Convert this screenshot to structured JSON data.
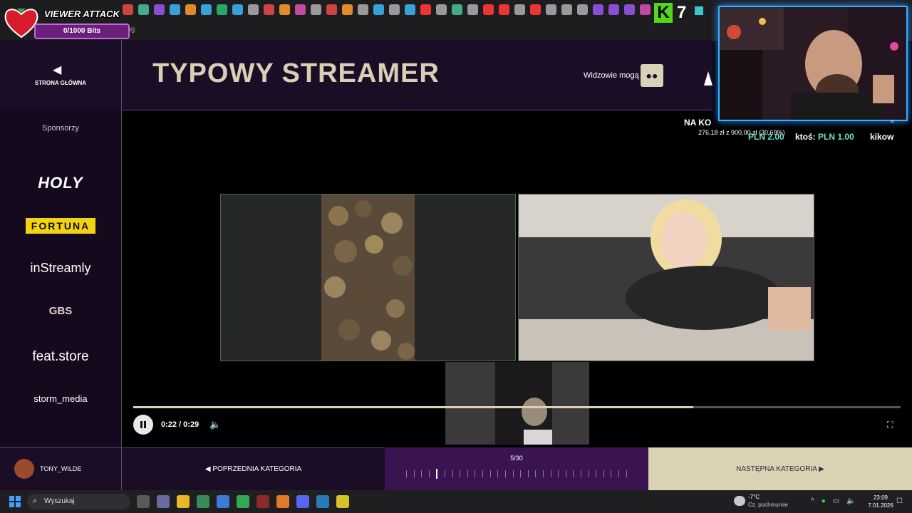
{
  "overlay": {
    "viewer_attack_title": "VIEWER ATTACK",
    "viewer_attack_progress": "0/1000 Bits",
    "k_badge_count": "7"
  },
  "browser": {
    "bookmark_text": "ing"
  },
  "header": {
    "home_label": "STRONA GŁÓWNA",
    "title": "TYPOWY STREAMER",
    "viewers_label": "Widzowie mogą"
  },
  "sidebar": {
    "title": "Sponsorzy",
    "sponsors": [
      "HOLY",
      "FORTUNA",
      "inStreamly",
      "GBS",
      "feat.store",
      "storm_media"
    ]
  },
  "donations": {
    "goal_title": "NA KO",
    "goal_amount": "276,18 zł z 900,00 zł (30,69%)",
    "ticker_1": "PLN 2.00",
    "ticker_2_name": "ktoś:",
    "ticker_2_amount": "PLN 1.00",
    "ticker_3": "kikow"
  },
  "player": {
    "time": "0:22 / 0:29",
    "progress": 0.73
  },
  "footer": {
    "username": "TONY_WILDE",
    "prev_label": "POPRZEDNIA KATEGORIA",
    "count": "5/30",
    "current_index": 5,
    "total": 30,
    "next_label": "NASTĘPNA KATEGORIA"
  },
  "taskbar": {
    "search_placeholder": "Wyszukaj",
    "weather_temp": "-7°C",
    "weather_desc": "Cz. pochmurnie",
    "time": "23:09",
    "date": "7.01.2026"
  }
}
